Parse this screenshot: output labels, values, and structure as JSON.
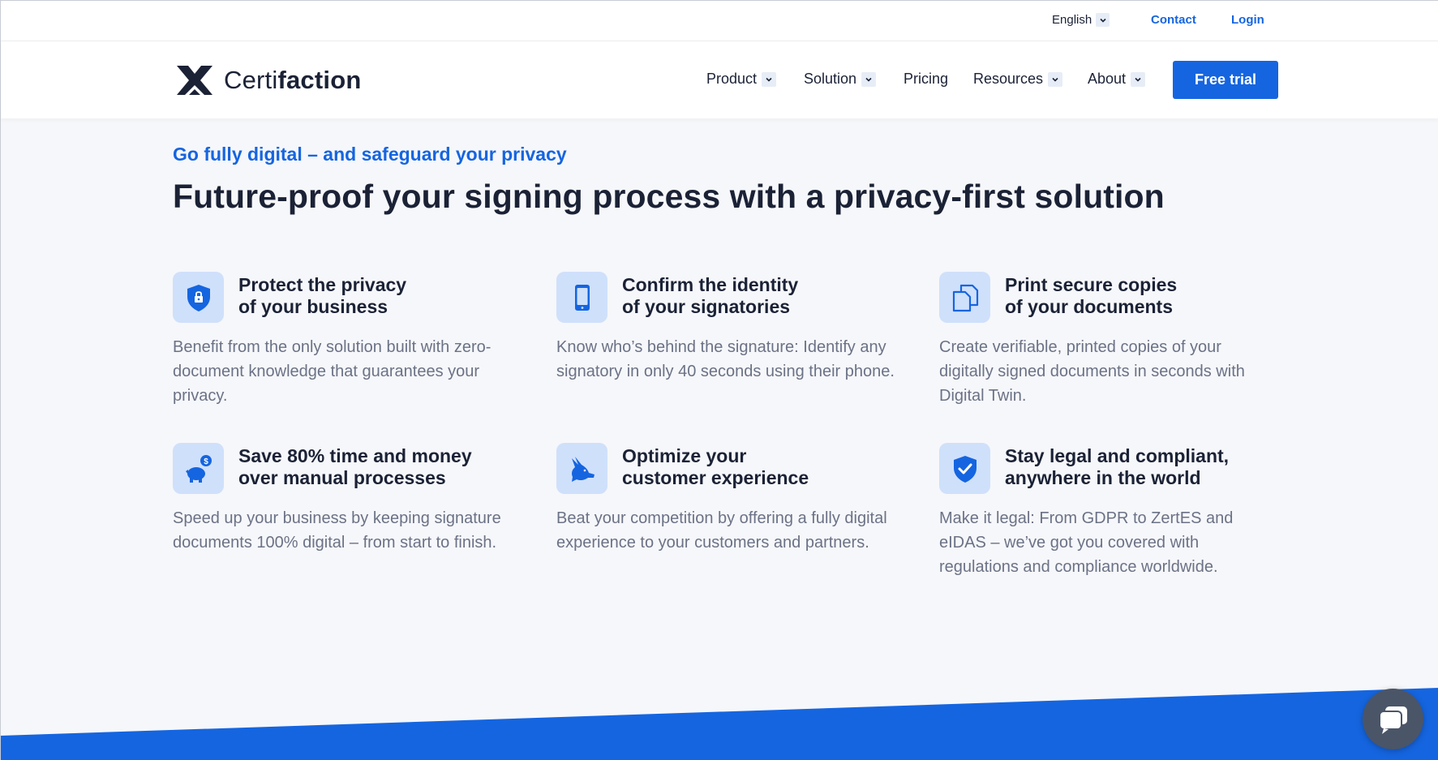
{
  "topbar": {
    "language": "English",
    "contact": "Contact",
    "login": "Login"
  },
  "brand": {
    "name_light": "Certi",
    "name_bold": "faction"
  },
  "nav": {
    "items": [
      {
        "label": "Product",
        "dropdown": true
      },
      {
        "label": "Solution",
        "dropdown": true
      },
      {
        "label": "Pricing",
        "dropdown": false
      },
      {
        "label": "Resources",
        "dropdown": true
      },
      {
        "label": "About",
        "dropdown": true
      }
    ],
    "cta": "Free trial"
  },
  "hero": {
    "eyebrow": "Go fully digital – and safeguard your privacy",
    "headline": "Future-proof your signing process with a privacy-first solution"
  },
  "features": [
    {
      "icon": "shield-lock-icon",
      "title_line1": "Protect the privacy",
      "title_line2": "of your business",
      "desc": "Benefit from the only solution built with zero-document knowledge that guarantees your privacy."
    },
    {
      "icon": "smartphone-icon",
      "title_line1": "Confirm the identity",
      "title_line2": "of your signatories",
      "desc": "Know who’s behind the signature: Identify any signatory in only 40 seconds using their phone."
    },
    {
      "icon": "copy-documents-icon",
      "title_line1": "Print secure copies",
      "title_line2": "of your documents",
      "desc": "Create verifiable, printed copies of your digitally signed documents in seconds with Digital Twin."
    },
    {
      "icon": "piggy-bank-icon",
      "title_line1": "Save 80% time and money",
      "title_line2": "over manual processes",
      "desc": "Speed up your business by keeping signature documents 100% digital – from start to finish."
    },
    {
      "icon": "rabbit-icon",
      "title_line1": "Optimize your",
      "title_line2": "customer experience",
      "desc": "Beat your competition by offering a fully digital experience to your customers and partners."
    },
    {
      "icon": "shield-check-icon",
      "title_line1": "Stay legal and compliant,",
      "title_line2": "anywhere in the world",
      "desc": "Make it legal: From GDPR to ZertES and eIDAS – we’ve got you covered with regulations and compliance worldwide."
    }
  ],
  "colors": {
    "accent": "#1565e0",
    "text": "#1b2236",
    "muted": "#6b7286",
    "background": "#f6f7fa",
    "icon_bg": "#cfe0fb"
  }
}
